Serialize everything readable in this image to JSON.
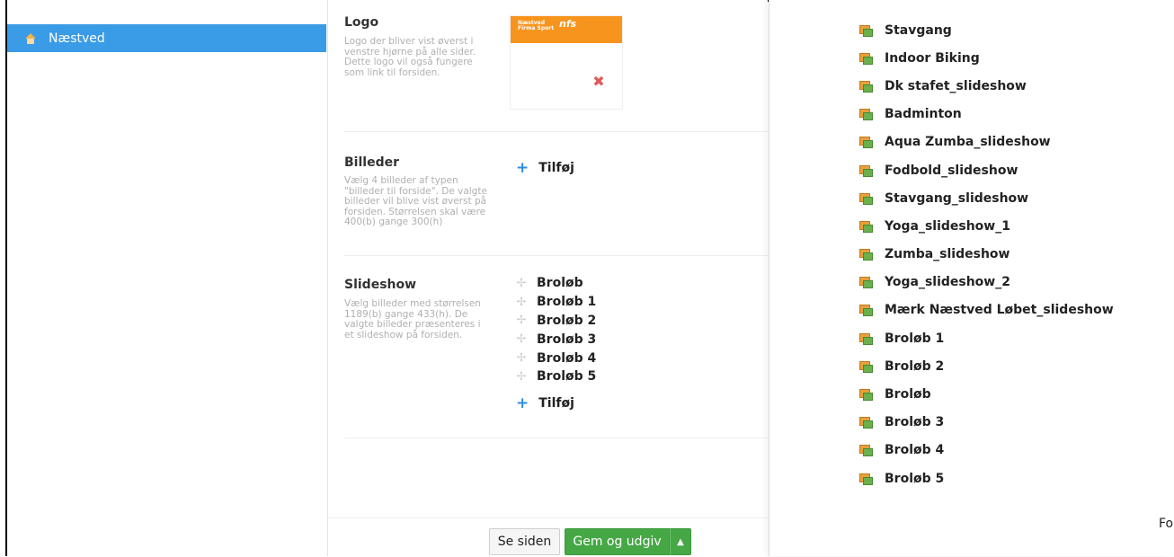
{
  "sidebar": {
    "items": [
      {
        "label": "Næstved",
        "icon": "home-icon"
      }
    ]
  },
  "logo_section": {
    "title": "Logo",
    "description": "Logo der bliver vist øverst i venstre hjørne på alle sider. Dette logo vil også fungere som link til forsiden.",
    "logo_text_line1": "Næstved",
    "logo_text_line2": "Firma Sport",
    "logo_mark": "nfs"
  },
  "images_section": {
    "title": "Billeder",
    "description": "Vælg 4 billeder af typen \"billeder til forside\". De valgte billeder vil blive vist øverst på forsiden. Størrelsen skal være 400(b) gange 300(h)",
    "add_label": "Tilføj"
  },
  "slideshow_section": {
    "title": "Slideshow",
    "description": "Vælg billeder med størrelsen 1189(b) gange 433(h). De valgte billeder præsenteres i et slideshow på forsiden.",
    "items": [
      "Broløb",
      "Broløb 1",
      "Broløb 2",
      "Broløb 3",
      "Broløb 4",
      "Broløb 5"
    ],
    "add_label": "Tilføj"
  },
  "footer": {
    "view_label": "Se siden",
    "publish_label": "Gem og udgiv",
    "caret": "▲"
  },
  "gallery": {
    "items": [
      "Stavgang",
      "Indoor Biking",
      "Dk stafet_slideshow",
      "Badminton",
      "Aqua Zumba_slideshow",
      "Fodbold_slideshow",
      "Stavgang_slideshow",
      "Yoga_slideshow_1",
      "Zumba_slideshow",
      "Yoga_slideshow_2",
      "Mærk Næstved Løbet_slideshow",
      "Broløb 1",
      "Broløb 2",
      "Broløb",
      "Broløb 3",
      "Broløb 4",
      "Broløb 5"
    ],
    "cut_text": "Fo"
  },
  "colors": {
    "nav_active": "#3a9be6",
    "publish_green": "#45a845",
    "logo_orange": "#f7941d",
    "remove_red": "#e05a5a",
    "add_blue": "#2d8ce6"
  }
}
